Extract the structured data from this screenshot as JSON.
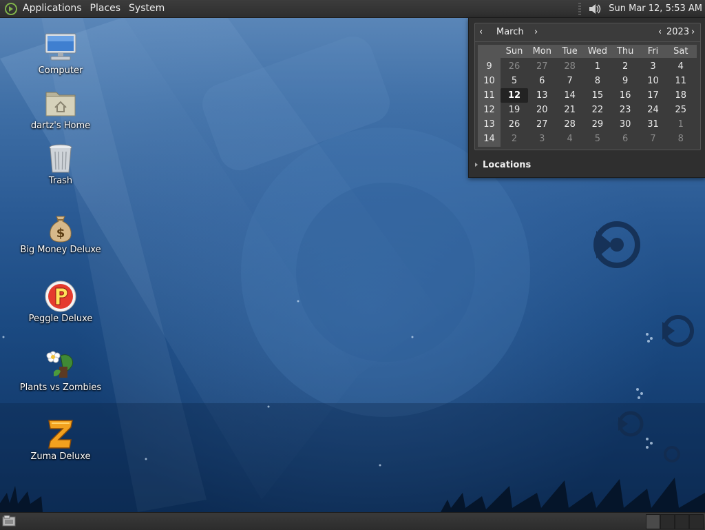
{
  "top_panel": {
    "menus": [
      "Applications",
      "Places",
      "System"
    ],
    "clock": "Sun Mar 12,  5:53 AM",
    "icons": {
      "logo": "mate-logo-icon",
      "volume": "speaker-volume-icon"
    }
  },
  "calendar": {
    "month": "March",
    "year": "2023",
    "prev_month": "‹",
    "next_month": "›",
    "prev_year": "‹",
    "next_year": "›",
    "weekdays": [
      "Sun",
      "Mon",
      "Tue",
      "Wed",
      "Thu",
      "Fri",
      "Sat"
    ],
    "weeks": [
      {
        "week": "9",
        "days": [
          {
            "d": "26",
            "dim": true
          },
          {
            "d": "27",
            "dim": true
          },
          {
            "d": "28",
            "dim": true
          },
          {
            "d": "1"
          },
          {
            "d": "2"
          },
          {
            "d": "3"
          },
          {
            "d": "4"
          }
        ]
      },
      {
        "week": "10",
        "days": [
          {
            "d": "5"
          },
          {
            "d": "6"
          },
          {
            "d": "7"
          },
          {
            "d": "8"
          },
          {
            "d": "9"
          },
          {
            "d": "10"
          },
          {
            "d": "11"
          }
        ]
      },
      {
        "week": "11",
        "days": [
          {
            "d": "12",
            "today": true
          },
          {
            "d": "13"
          },
          {
            "d": "14"
          },
          {
            "d": "15"
          },
          {
            "d": "16"
          },
          {
            "d": "17"
          },
          {
            "d": "18"
          }
        ]
      },
      {
        "week": "12",
        "days": [
          {
            "d": "19"
          },
          {
            "d": "20"
          },
          {
            "d": "21"
          },
          {
            "d": "22"
          },
          {
            "d": "23"
          },
          {
            "d": "24"
          },
          {
            "d": "25"
          }
        ]
      },
      {
        "week": "13",
        "days": [
          {
            "d": "26"
          },
          {
            "d": "27"
          },
          {
            "d": "28"
          },
          {
            "d": "29"
          },
          {
            "d": "30"
          },
          {
            "d": "31"
          },
          {
            "d": "1",
            "dim": true
          }
        ]
      },
      {
        "week": "14",
        "days": [
          {
            "d": "2",
            "dim": true
          },
          {
            "d": "3",
            "dim": true
          },
          {
            "d": "4",
            "dim": true
          },
          {
            "d": "5",
            "dim": true
          },
          {
            "d": "6",
            "dim": true
          },
          {
            "d": "7",
            "dim": true
          },
          {
            "d": "8",
            "dim": true
          }
        ]
      }
    ],
    "locations_label": "Locations"
  },
  "desktop_icons": [
    {
      "label": "Computer",
      "icon": "computer-monitor-icon"
    },
    {
      "label": "dartz's Home",
      "icon": "home-folder-icon"
    },
    {
      "label": "Trash",
      "icon": "trash-can-icon"
    },
    {
      "label": "Big Money Deluxe",
      "icon": "money-bag-icon"
    },
    {
      "label": "Peggle Deluxe",
      "icon": "peggle-logo-icon"
    },
    {
      "label": "Plants vs Zombies",
      "icon": "plants-vs-zombies-icon"
    },
    {
      "label": "Zuma Deluxe",
      "icon": "zuma-logo-icon"
    }
  ],
  "bottom_panel": {
    "icons": {
      "show_desktop": "show-desktop-icon"
    },
    "workspaces": 4,
    "active_workspace": 1
  },
  "colors": {
    "panel": "#333333",
    "popup": "#2f2f2f",
    "today_bg": "#232323",
    "wallpaper": "#2a5a94"
  }
}
